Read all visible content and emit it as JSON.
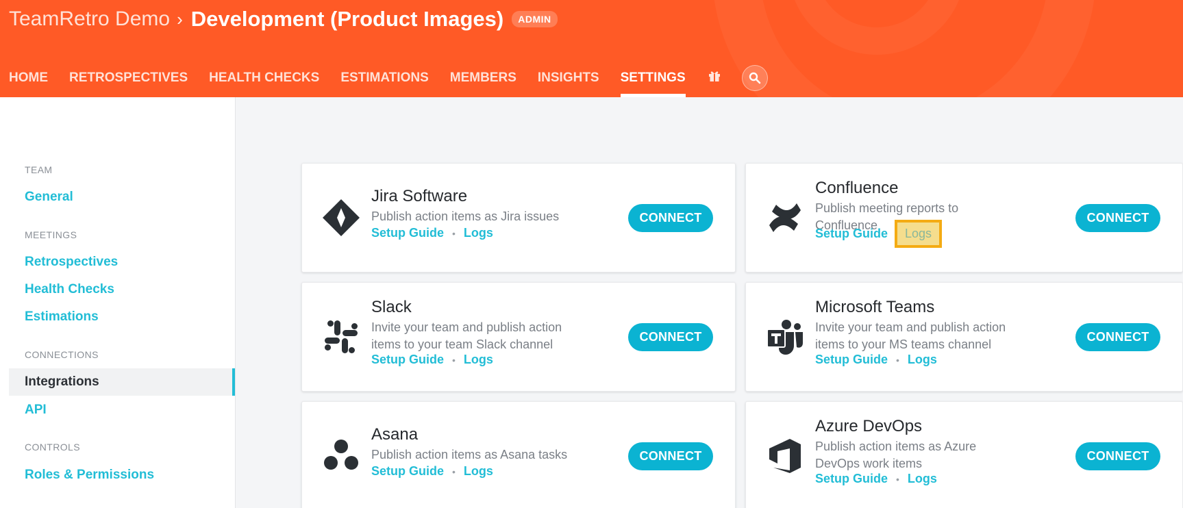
{
  "header": {
    "team": "TeamRetro Demo",
    "separator": "›",
    "title": "Development (Product Images)",
    "badge": "ADMIN",
    "nav": [
      "HOME",
      "RETROSPECTIVES",
      "HEALTH CHECKS",
      "ESTIMATIONS",
      "MEMBERS",
      "INSIGHTS",
      "SETTINGS"
    ],
    "active_nav": "SETTINGS",
    "gift_icon": "gift-icon",
    "search_icon": "search-icon"
  },
  "sidebar": {
    "team_label": "TEAM",
    "general": "General",
    "meetings_label": "MEETINGS",
    "retrospectives": "Retrospectives",
    "health_checks": "Health Checks",
    "estimations": "Estimations",
    "connections_label": "CONNECTIONS",
    "integrations": "Integrations",
    "api": "API",
    "controls_label": "CONTROLS",
    "roles": "Roles & Permissions"
  },
  "integrations": [
    {
      "name": "Jira Software",
      "desc": "Publish action items as Jira issues",
      "setup": "Setup Guide",
      "logs": "Logs",
      "button": "CONNECT",
      "icon": "jira-icon"
    },
    {
      "name": "Confluence",
      "desc": "Publish meeting reports to Confluence",
      "setup": "Setup Guide",
      "logs": "Logs",
      "button": "CONNECT",
      "icon": "confluence-icon"
    },
    {
      "name": "Slack",
      "desc": "Invite your team and publish action items to your team Slack channel",
      "setup": "Setup Guide",
      "logs": "Logs",
      "button": "CONNECT",
      "icon": "slack-icon"
    },
    {
      "name": "Microsoft Teams",
      "desc": "Invite your team and publish action items to your MS teams channel",
      "setup": "Setup Guide",
      "logs": "Logs",
      "button": "CONNECT",
      "icon": "microsoft-teams-icon"
    },
    {
      "name": "Asana",
      "desc": "Publish action items as Asana tasks",
      "setup": "Setup Guide",
      "logs": "Logs",
      "button": "CONNECT",
      "icon": "asana-icon"
    },
    {
      "name": "Azure DevOps",
      "desc": "Publish action items as Azure DevOps work items",
      "setup": "Setup Guide",
      "logs": "Logs",
      "button": "CONNECT",
      "icon": "azure-devops-icon"
    }
  ],
  "colors": {
    "header": "#ff5a26",
    "accent": "#22bdd6",
    "button": "#0bb3d2",
    "highlight_fill": "#f5dd8d",
    "highlight_border": "#f4ab13"
  }
}
